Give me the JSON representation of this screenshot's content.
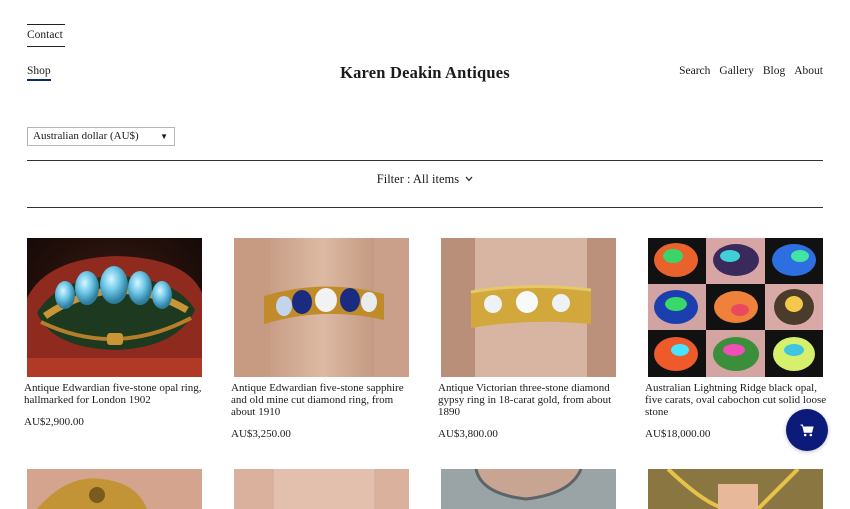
{
  "header": {
    "contact": "Contact",
    "shop": "Shop",
    "brand": "Karen Deakin Antiques",
    "nav": [
      "Search",
      "Gallery",
      "Blog",
      "About"
    ]
  },
  "currency": {
    "selected": "Australian dollar (AU$)"
  },
  "filter": {
    "label": "Filter : All items"
  },
  "products": [
    {
      "title": "Antique Edwardian five-stone opal ring, hallmarked for London 1902",
      "price": "AU$2,900.00"
    },
    {
      "title": "Antique Edwardian five-stone sapphire and old mine cut diamond ring, from about 1910",
      "price": "AU$3,250.00"
    },
    {
      "title": "Antique Victorian three-stone diamond gypsy ring in 18-carat gold, from about 1890",
      "price": "AU$3,800.00"
    },
    {
      "title": "Australian Lightning Ridge black opal, five carats, oval cabochon cut solid loose stone",
      "price": "AU$18,000.00"
    }
  ],
  "colors": {
    "accent": "#0c1a7a"
  },
  "icons": {
    "cart": "cart-icon",
    "chevron": "chevron-down-icon"
  }
}
